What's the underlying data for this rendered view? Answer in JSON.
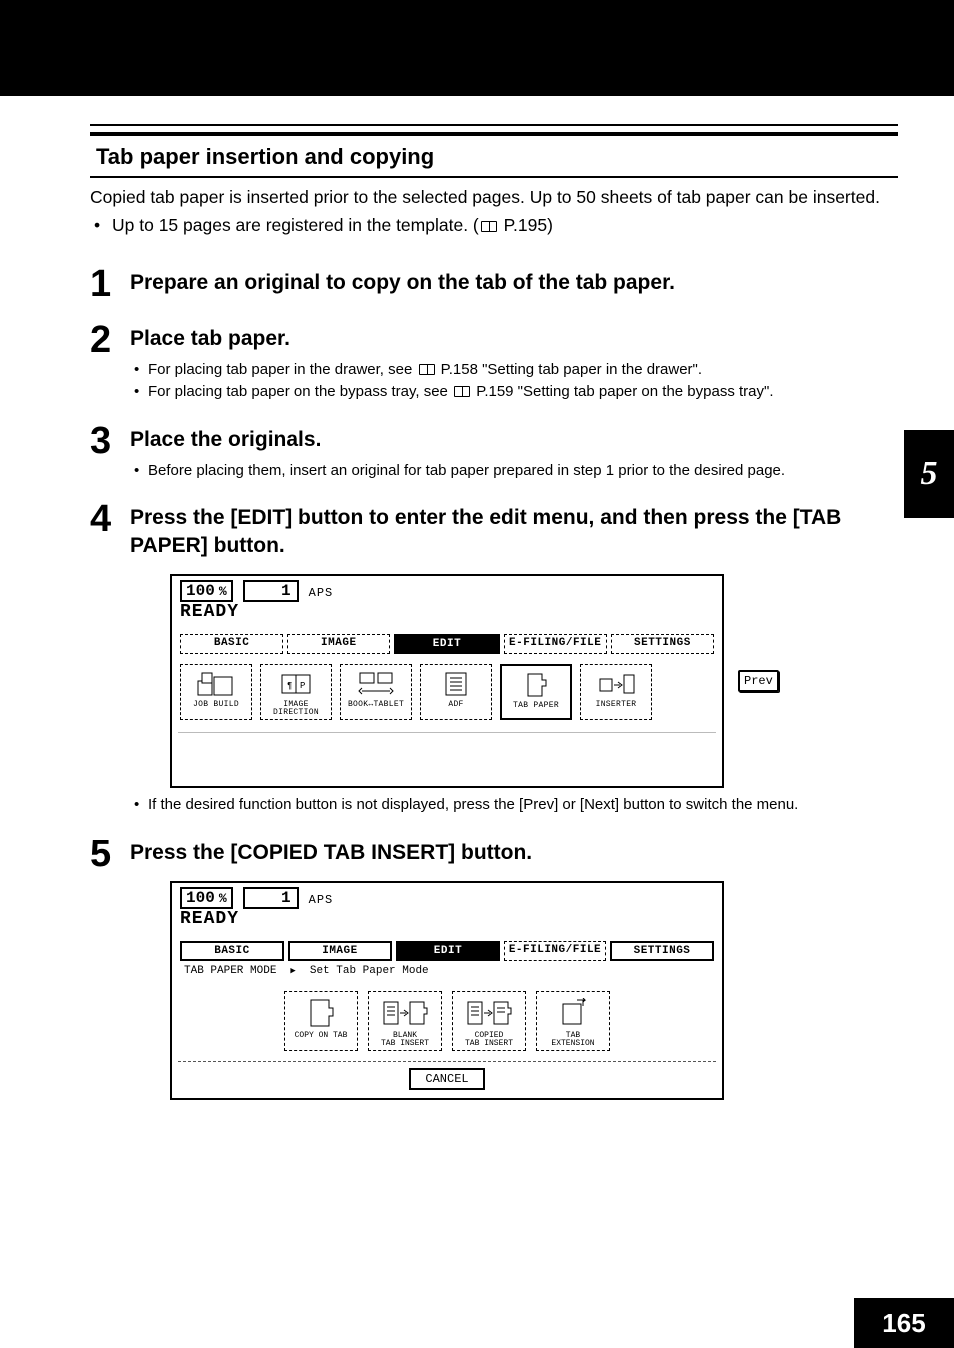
{
  "chapter_tab": "5",
  "page_number": "165",
  "section": {
    "title": "Tab paper insertion and copying",
    "intro": "Copied tab paper is inserted prior to the selected pages. Up to 50 sheets of tab paper can be inserted.",
    "intro_bullet": "Up to 15 pages are registered in the template. (",
    "intro_bullet_ref": " P.195)"
  },
  "steps": [
    {
      "num": "1",
      "title": "Prepare an original to copy on the tab of the tab paper."
    },
    {
      "num": "2",
      "title": "Place tab paper.",
      "subs": [
        {
          "pre": "For placing tab paper in the drawer, see ",
          "ref": " P.158 \"Setting tab paper in the drawer\"."
        },
        {
          "pre": "For placing tab paper on the bypass tray, see ",
          "ref": " P.159 \"Setting tab paper on the bypass tray\"."
        }
      ]
    },
    {
      "num": "3",
      "title": "Place the originals.",
      "subs": [
        {
          "pre": "Before placing them, insert an original for tab paper prepared in step 1 prior to the desired page.",
          "ref": ""
        }
      ]
    },
    {
      "num": "4",
      "title": "Press the [EDIT] button to enter the edit menu, and then press the [TAB PAPER] button.",
      "after_note": "If the desired function button is not displayed, press the [Prev] or [Next] button to switch the menu."
    },
    {
      "num": "5",
      "title": "Press the [COPIED TAB INSERT] button."
    }
  ],
  "screen1": {
    "zoom": "100",
    "pct": "%",
    "count": "1",
    "aps": "APS",
    "ready": "READY",
    "tabs": [
      "BASIC",
      "IMAGE",
      "EDIT",
      "E-FILING/FILE",
      "SETTINGS"
    ],
    "active_tab": 2,
    "icons": [
      {
        "label": "JOB BUILD"
      },
      {
        "label": "IMAGE DIRECTION"
      },
      {
        "label": "BOOK↔TABLET"
      },
      {
        "label": "ADF"
      },
      {
        "label": "TAB PAPER"
      },
      {
        "label": "INSERTER"
      }
    ],
    "prev": "Prev"
  },
  "screen2": {
    "zoom": "100",
    "pct": "%",
    "count": "1",
    "aps": "APS",
    "ready": "READY",
    "tabs": [
      "BASIC",
      "IMAGE",
      "EDIT",
      "E-FILING/FILE",
      "SETTINGS"
    ],
    "active_tab": 2,
    "mode_label": "TAB PAPER MODE",
    "mode_hint": "Set Tab Paper Mode",
    "modes": [
      {
        "label": "COPY ON TAB"
      },
      {
        "label": "BLANK\nTAB INSERT"
      },
      {
        "label": "COPIED\nTAB INSERT"
      },
      {
        "label": "TAB\nEXTENSION"
      }
    ],
    "cancel": "CANCEL"
  }
}
